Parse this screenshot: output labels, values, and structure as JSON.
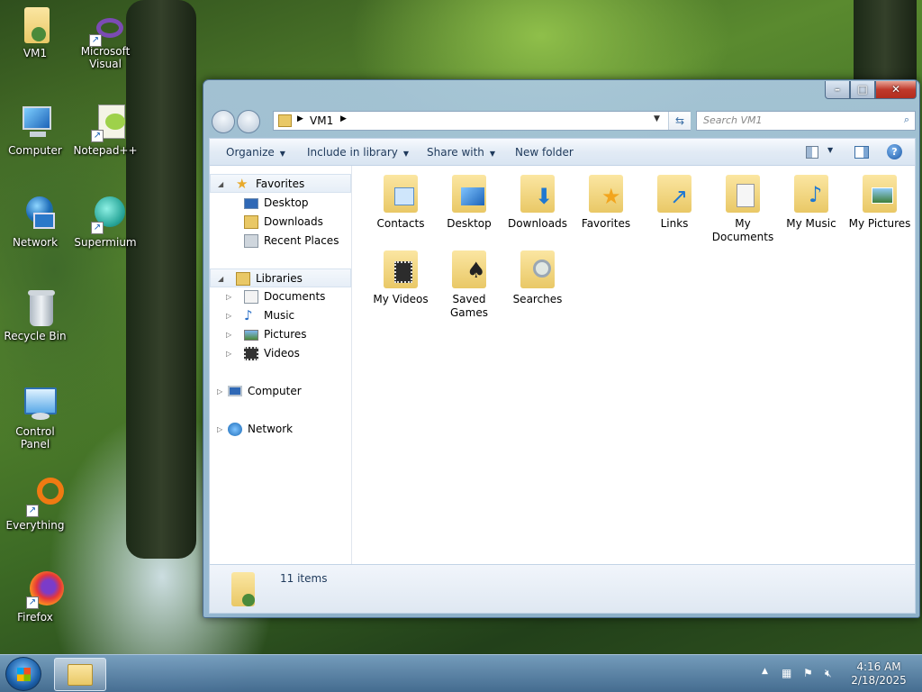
{
  "desktop": {
    "icons": [
      {
        "label": "VM1"
      },
      {
        "label": "Microsoft Visual Stud..."
      },
      {
        "label": "Computer"
      },
      {
        "label": "Notepad++"
      },
      {
        "label": "Network"
      },
      {
        "label": "Supermium"
      },
      {
        "label": "Recycle Bin"
      },
      {
        "label": "Control Panel"
      },
      {
        "label": "Everything"
      },
      {
        "label": "Firefox"
      }
    ]
  },
  "explorer": {
    "address": {
      "segment": "VM1"
    },
    "search_placeholder": "Search VM1",
    "toolbar": {
      "organize": "Organize",
      "include_in_library": "Include in library",
      "share_with": "Share with",
      "new_folder": "New folder"
    },
    "nav": {
      "favorites": "Favorites",
      "desktop": "Desktop",
      "downloads": "Downloads",
      "recent_places": "Recent Places",
      "libraries": "Libraries",
      "documents": "Documents",
      "music": "Music",
      "pictures": "Pictures",
      "videos": "Videos",
      "computer": "Computer",
      "network": "Network"
    },
    "items": [
      {
        "label": "Contacts"
      },
      {
        "label": "Desktop"
      },
      {
        "label": "Downloads"
      },
      {
        "label": "Favorites"
      },
      {
        "label": "Links"
      },
      {
        "label": "My Documents"
      },
      {
        "label": "My Music"
      },
      {
        "label": "My Pictures"
      },
      {
        "label": "My Videos"
      },
      {
        "label": "Saved Games"
      },
      {
        "label": "Searches"
      }
    ],
    "status_count": "11 items"
  },
  "taskbar": {
    "time": "4:16 AM",
    "date": "2/18/2025"
  },
  "colors": {
    "folder": "#e9c866",
    "toolbar_text": "#1e395b",
    "close_button": "#c0392b"
  }
}
